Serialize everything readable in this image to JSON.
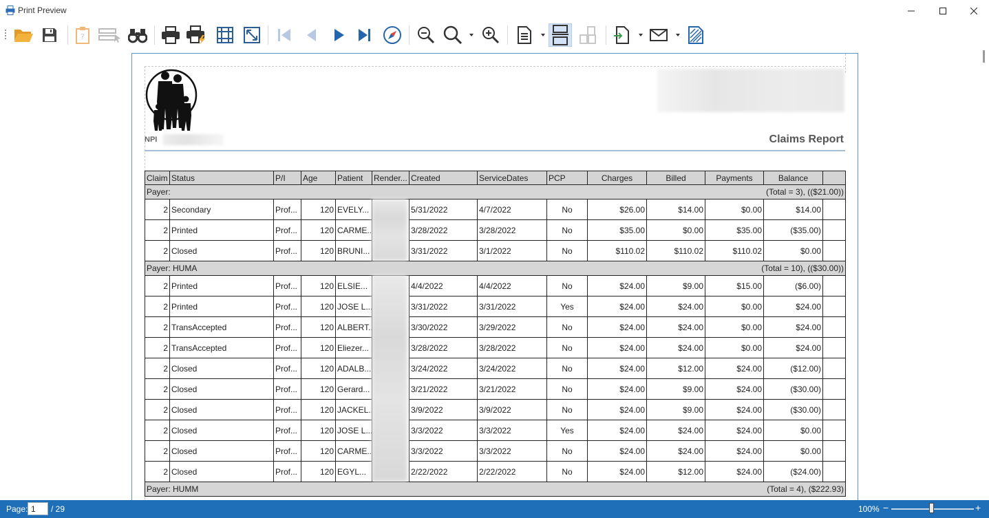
{
  "window": {
    "title": "Print Preview"
  },
  "toolbar": {
    "items": [
      "open-icon",
      "save-icon",
      "parameters-icon",
      "editing-fields-icon",
      "find-icon",
      "print-icon",
      "quick-print-icon",
      "page-setup-icon",
      "scale-icon",
      "first-page-icon",
      "previous-page-icon",
      "next-page-icon",
      "last-page-icon",
      "navigation-icon",
      "zoom-out-icon",
      "zoom-icon",
      "zoom-in-icon",
      "view-mode-icon",
      "continuous-view-icon",
      "multiple-pages-icon",
      "export-icon",
      "send-email-icon",
      "watermark-icon"
    ]
  },
  "report": {
    "npi_label": "NPI",
    "title": "Claims Report",
    "columns": [
      "Claim",
      "Status",
      "P/I",
      "Age",
      "Patient",
      "Render...",
      "Created",
      "ServiceDates",
      "PCP",
      "Charges",
      "Billed",
      "Payments",
      "Balance",
      ""
    ],
    "groups": [
      {
        "label": "Payer:",
        "summary": "(Total = 3), (($21.00))",
        "rows": [
          {
            "claim": "2",
            "status": "Secondary",
            "pi": "Prof...",
            "age": "120",
            "patient": "EVELY...",
            "created": "5/31/2022",
            "service": "4/7/2022",
            "pcp": "No",
            "charges": "$26.00",
            "billed": "$14.00",
            "payments": "$0.00",
            "balance": "$14.00"
          },
          {
            "claim": "2",
            "status": "Printed",
            "pi": "Prof...",
            "age": "120",
            "patient": "CARME...",
            "created": "3/28/2022",
            "service": "3/28/2022",
            "pcp": "No",
            "charges": "$35.00",
            "billed": "$0.00",
            "payments": "$35.00",
            "balance": "($35.00)"
          },
          {
            "claim": "2",
            "status": "Closed",
            "pi": "Prof...",
            "age": "120",
            "patient": "BRUNI...",
            "created": "3/31/2022",
            "service": "3/1/2022",
            "pcp": "No",
            "charges": "$110.02",
            "billed": "$110.02",
            "payments": "$110.02",
            "balance": "$0.00"
          }
        ]
      },
      {
        "label": "Payer: HUMA",
        "summary": "(Total = 10), (($30.00))",
        "rows": [
          {
            "claim": "2",
            "status": "Printed",
            "pi": "Prof...",
            "age": "120",
            "patient": "ELSIE...",
            "created": "4/4/2022",
            "service": "4/4/2022",
            "pcp": "No",
            "charges": "$24.00",
            "billed": "$9.00",
            "payments": "$15.00",
            "balance": "($6.00)"
          },
          {
            "claim": "2",
            "status": "Printed",
            "pi": "Prof...",
            "age": "120",
            "patient": "JOSE L...",
            "created": "3/31/2022",
            "service": "3/31/2022",
            "pcp": "Yes",
            "charges": "$24.00",
            "billed": "$24.00",
            "payments": "$0.00",
            "balance": "$24.00"
          },
          {
            "claim": "2",
            "status": "TransAccepted",
            "pi": "Prof...",
            "age": "120",
            "patient": "ALBERT...",
            "created": "3/30/2022",
            "service": "3/29/2022",
            "pcp": "No",
            "charges": "$24.00",
            "billed": "$24.00",
            "payments": "$0.00",
            "balance": "$24.00"
          },
          {
            "claim": "2",
            "status": "TransAccepted",
            "pi": "Prof...",
            "age": "120",
            "patient": "Eliezer...",
            "created": "3/28/2022",
            "service": "3/28/2022",
            "pcp": "No",
            "charges": "$24.00",
            "billed": "$24.00",
            "payments": "$0.00",
            "balance": "$24.00"
          },
          {
            "claim": "2",
            "status": "Closed",
            "pi": "Prof...",
            "age": "120",
            "patient": "ADALB...",
            "created": "3/24/2022",
            "service": "3/24/2022",
            "pcp": "No",
            "charges": "$24.00",
            "billed": "$12.00",
            "payments": "$24.00",
            "balance": "($12.00)"
          },
          {
            "claim": "2",
            "status": "Closed",
            "pi": "Prof...",
            "age": "120",
            "patient": "Gerard...",
            "created": "3/21/2022",
            "service": "3/21/2022",
            "pcp": "No",
            "charges": "$24.00",
            "billed": "$9.00",
            "payments": "$24.00",
            "balance": "($30.00)"
          },
          {
            "claim": "2",
            "status": "Closed",
            "pi": "Prof...",
            "age": "120",
            "patient": "JACKEL...",
            "created": "3/9/2022",
            "service": "3/9/2022",
            "pcp": "No",
            "charges": "$24.00",
            "billed": "$9.00",
            "payments": "$24.00",
            "balance": "($30.00)"
          },
          {
            "claim": "2",
            "status": "Closed",
            "pi": "Prof...",
            "age": "120",
            "patient": "JOSE L...",
            "created": "3/3/2022",
            "service": "3/3/2022",
            "pcp": "Yes",
            "charges": "$24.00",
            "billed": "$24.00",
            "payments": "$24.00",
            "balance": "$0.00"
          },
          {
            "claim": "2",
            "status": "Closed",
            "pi": "Prof...",
            "age": "120",
            "patient": "CARME...",
            "created": "3/3/2022",
            "service": "3/3/2022",
            "pcp": "No",
            "charges": "$24.00",
            "billed": "$24.00",
            "payments": "$24.00",
            "balance": "$0.00"
          },
          {
            "claim": "2",
            "status": "Closed",
            "pi": "Prof...",
            "age": "120",
            "patient": "EGYL...",
            "created": "2/22/2022",
            "service": "2/22/2022",
            "pcp": "No",
            "charges": "$24.00",
            "billed": "$12.00",
            "payments": "$24.00",
            "balance": "($24.00)"
          }
        ]
      },
      {
        "label": "Payer: HUMM",
        "summary": "(Total = 4), ($222.93)",
        "rows": []
      }
    ]
  },
  "statusbar": {
    "page_label": "Page:",
    "page_value": "1",
    "page_total": "/ 29",
    "zoom_label": "100%",
    "zoom_minus": "−",
    "zoom_plus": "+"
  }
}
